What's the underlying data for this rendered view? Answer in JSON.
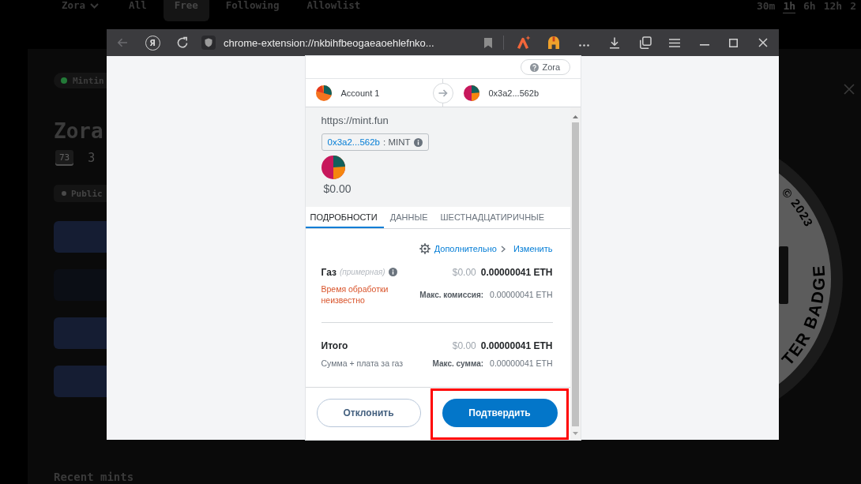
{
  "background_page": {
    "top_bar": {
      "collection": "Zora",
      "tabs": [
        {
          "label": "All",
          "selected": false
        },
        {
          "label": "Free",
          "selected": true
        },
        {
          "label": "Following",
          "selected": false
        },
        {
          "label": "Allowlist",
          "selected": false
        }
      ],
      "time_ranges": [
        {
          "label": "30m",
          "selected": false
        },
        {
          "label": "1h",
          "selected": true
        },
        {
          "label": "6h",
          "selected": false
        },
        {
          "label": "12h",
          "selected": false
        },
        {
          "label": "2",
          "selected": false
        }
      ]
    },
    "modal": {
      "status": "Mintin",
      "title": "Zora",
      "counts": [
        {
          "label": "73",
          "selected": true
        },
        {
          "label": "3",
          "selected": false
        }
      ],
      "phase": "Public",
      "cards": [
        {
          "dimmed": false
        },
        {
          "dimmed": true
        },
        {
          "dimmed": false
        },
        {
          "dimmed": false
        }
      ],
      "section_title": "Recent mints",
      "badge_texts": [
        "© 2023",
        "TER BADGE"
      ]
    }
  },
  "browser": {
    "back_disabled": true,
    "home_button": "Я",
    "address": "chrome-extension://nkbihfbeogaeaoehlefnko..."
  },
  "popup": {
    "network": "Zora",
    "from_account": "Account 1",
    "to_address": "0x3a2...562b",
    "origin": "https://mint.fun",
    "contract": {
      "address": "0x3a2...562b",
      "method": ": MINT"
    },
    "amount": "$0.00",
    "tabs": [
      {
        "label": "ПОДРОБНОСТИ",
        "selected": true
      },
      {
        "label": "ДАННЫЕ",
        "selected": false
      },
      {
        "label": "ШЕСТНАДЦАТИРИЧНЫЕ",
        "selected": false
      }
    ],
    "links": {
      "advanced": "Дополнительно",
      "edit": "Изменить"
    },
    "gas": {
      "label": "Газ",
      "hint": "(примерная)",
      "fiat": "$0.00",
      "amount": "0.00000041 ETH",
      "timing": "Время обработки неизвестно",
      "max_label": "Макс. комиссия:",
      "max_value": "0.00000041 ETH"
    },
    "total": {
      "label": "Итого",
      "fiat": "$0.00",
      "amount": "0.00000041 ETH",
      "note": "Сумма + плата за газ",
      "max_label": "Макс. сумма:",
      "max_value": "0.00000041 ETH"
    },
    "buttons": [
      {
        "label": "Отклонить",
        "kind": "secondary",
        "highlighted": false
      },
      {
        "label": "Подтвердить",
        "kind": "primary",
        "highlighted": true
      }
    ]
  }
}
